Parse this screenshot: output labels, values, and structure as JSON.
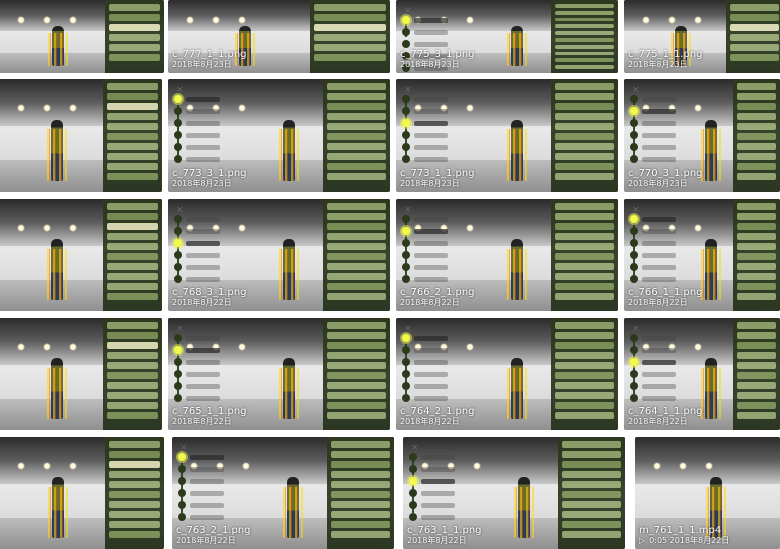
{
  "thumbnails": [
    {
      "file": "",
      "date": "",
      "variant": "panel"
    },
    {
      "file": "c_777_1_1.png",
      "date": "2018年8月23日",
      "variant": "panel"
    },
    {
      "file": "c_775_3_1.png",
      "date": "2018年8月23日",
      "variant": "steps"
    },
    {
      "file": "c_775_1_1.png",
      "date": "2018年8月23日",
      "variant": "panel"
    },
    {
      "file": "",
      "date": "",
      "variant": "panel"
    },
    {
      "file": "c_773_3_1.png",
      "date": "2018年8月23日",
      "variant": "steps"
    },
    {
      "file": "c_773_1_1.png",
      "date": "2018年8月23日",
      "variant": "steps"
    },
    {
      "file": "c_770_3_1.png",
      "date": "2018年8月23日",
      "variant": "steps"
    },
    {
      "file": "",
      "date": "",
      "variant": "panel"
    },
    {
      "file": "c_768_3_1.png",
      "date": "2018年8月22日",
      "variant": "steps"
    },
    {
      "file": "c_766_2_1.png",
      "date": "2018年8月22日",
      "variant": "steps"
    },
    {
      "file": "c_766_1_1.png",
      "date": "2018年8月22日",
      "variant": "steps"
    },
    {
      "file": "",
      "date": "",
      "variant": "panel"
    },
    {
      "file": "c_765_1_1.png",
      "date": "2018年8月22日",
      "variant": "steps"
    },
    {
      "file": "c_764_2_1.png",
      "date": "2018年8月22日",
      "variant": "steps"
    },
    {
      "file": "c_764_1_1.png",
      "date": "2018年8月22日",
      "variant": "steps"
    },
    {
      "file": "",
      "date": "",
      "variant": "panel"
    },
    {
      "file": "c_763_2_1.png",
      "date": "2018年8月22日",
      "variant": "steps"
    },
    {
      "file": "c_763_1_1.png",
      "date": "2018年8月22日",
      "variant": "steps"
    },
    {
      "file": "m_761_1_1.mp4",
      "date": "2018年8月22日",
      "variant": "video",
      "duration": "0:05"
    }
  ],
  "colors": {
    "panel": "#2e3a1f",
    "accent": "#f2f94a",
    "chip": "#b7c98a"
  }
}
